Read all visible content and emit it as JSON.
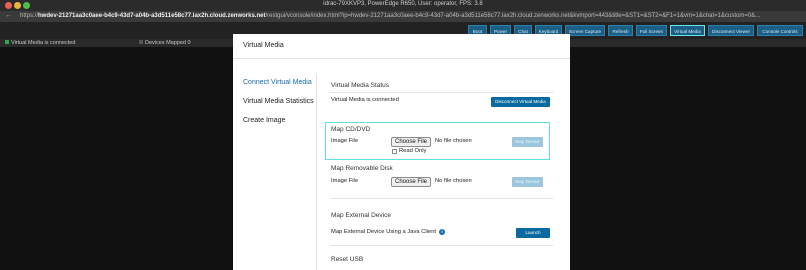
{
  "window": {
    "title": "idrac-79XKVP3, PowerEdge R650, User: operator, FPS: 3.8",
    "url_prefix": "https://",
    "url_host": "hwdev-21271aa3c0aee-b4c9-43d7-a04b-a3d511e58c77.lax2h.cloud.zenworks.net",
    "url_rest": "/restgui/vconsole/index.html?ip=hwdev-21271aa3c0aee-b4c9-43d7-a04b-a3d511e58c77.lax2h.cloud.zenworks.net&kvmport=443&title=&ST1=&ST2=&F1=1&vm=1&chat=1&custom=0&..."
  },
  "toolbar": {
    "buttons": [
      "Boot",
      "Power",
      "Chat",
      "Keyboard",
      "Screen Capture",
      "Refresh",
      "Full Screen",
      "Virtual Media",
      "Disconnect Viewer",
      "Console Controls"
    ]
  },
  "status": {
    "vm_connected": "Virtual Media is connected",
    "devices_mapped": "Devices Mapped 0",
    "dot_color_ok": "#2fa84f",
    "dot_color_off": "#555555"
  },
  "modal": {
    "title": "Virtual Media",
    "sidebar": [
      "Connect Virtual Media",
      "Virtual Media Statistics",
      "Create Image"
    ],
    "status_section": {
      "title": "Virtual Media Status",
      "text": "Virtual Media is connected",
      "button": "Disconnect Virtual Media"
    },
    "cd_section": {
      "title": "Map CD/DVD",
      "image_label": "Image File",
      "file_button": "Choose File",
      "file_status": "No file chosen",
      "readonly_label": "Read Only",
      "map_button": "Map Device"
    },
    "removable_section": {
      "title": "Map Removable Disk",
      "image_label": "Image File",
      "file_button": "Choose File",
      "file_status": "No file chosen",
      "map_button": "Map Device"
    },
    "external_section": {
      "title": "Map External Device",
      "text": "Map External Device Using a Java Client",
      "info_glyph": "i",
      "button": "Launch"
    },
    "reset_section": {
      "title": "Reset USB"
    }
  }
}
